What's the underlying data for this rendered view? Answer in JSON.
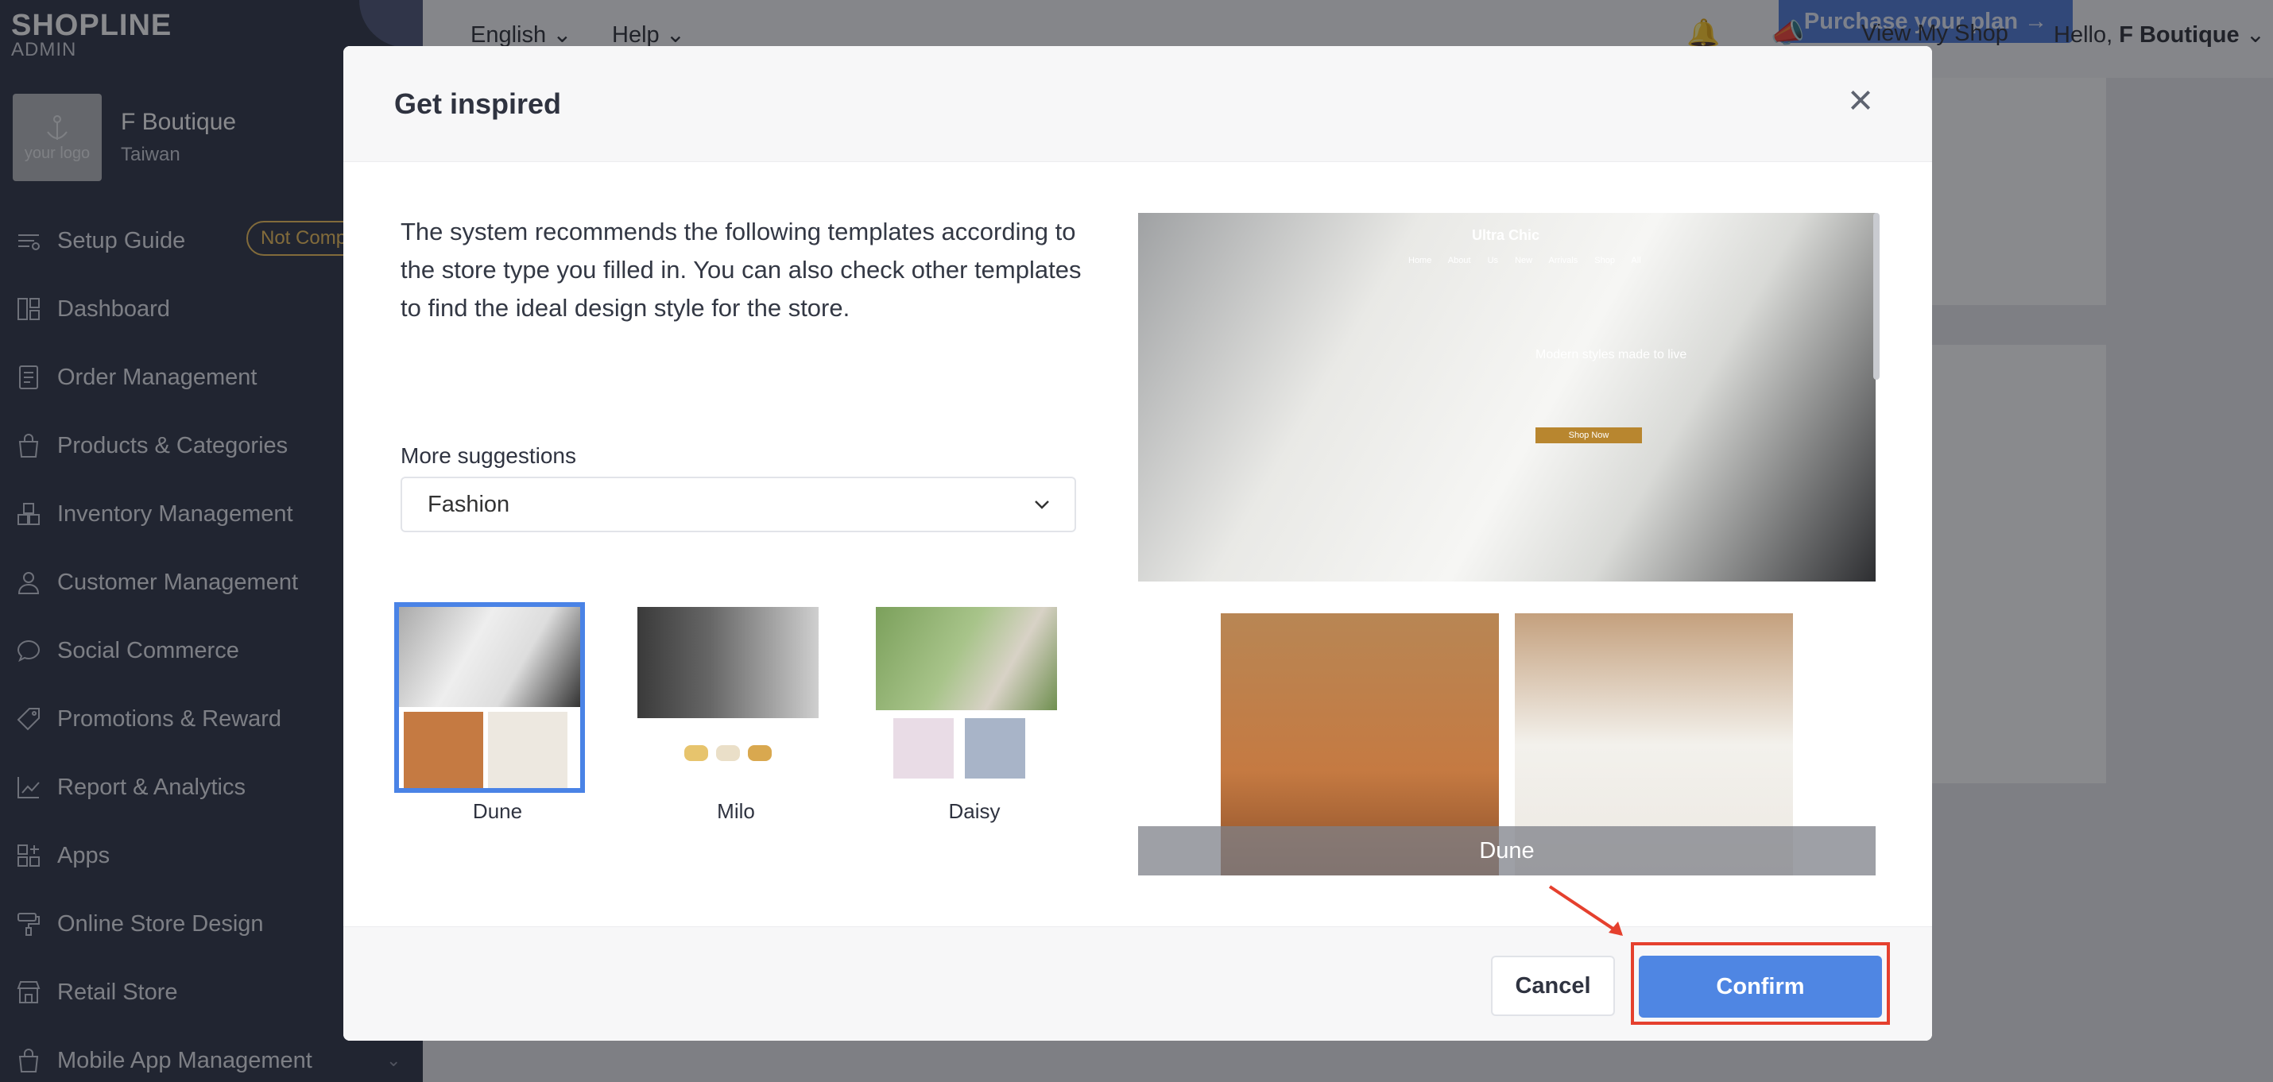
{
  "brand": {
    "name": "SHOPLINE",
    "sub": "ADMIN"
  },
  "store": {
    "logo_text": "your logo",
    "name": "F Boutique",
    "country": "Taiwan"
  },
  "sidebar": {
    "items": [
      {
        "label": "Setup Guide",
        "icon": "setup-guide-icon",
        "badge": "Not Comp"
      },
      {
        "label": "Dashboard",
        "icon": "dashboard-icon"
      },
      {
        "label": "Order Management",
        "icon": "order-icon"
      },
      {
        "label": "Products & Categories",
        "icon": "bag-icon"
      },
      {
        "label": "Inventory Management",
        "icon": "inventory-icon"
      },
      {
        "label": "Customer Management",
        "icon": "user-icon"
      },
      {
        "label": "Social Commerce",
        "icon": "chat-icon"
      },
      {
        "label": "Promotions & Reward",
        "icon": "tag-icon"
      },
      {
        "label": "Report & Analytics",
        "icon": "chart-icon"
      },
      {
        "label": "Apps",
        "icon": "apps-icon"
      },
      {
        "label": "Online Store Design",
        "icon": "paint-roller-icon"
      },
      {
        "label": "Retail Store",
        "icon": "store-icon"
      },
      {
        "label": "Mobile App Management",
        "icon": "mobile-icon"
      }
    ]
  },
  "topbar": {
    "language": "English",
    "help": "Help",
    "purchase": "Purchase your plan →",
    "view_shop": "View My Shop",
    "greeting": "Hello,",
    "user": "F Boutique"
  },
  "modal": {
    "title": "Get inspired",
    "description": "The system recommends the following templates according to the store type you filled in. You can also check other templates to find the ideal design style for the store.",
    "more_label": "More suggestions",
    "select_value": "Fashion",
    "templates": [
      {
        "name": "Dune",
        "selected": true
      },
      {
        "name": "Milo",
        "selected": false
      },
      {
        "name": "Daisy",
        "selected": false
      }
    ],
    "preview": {
      "site_title": "Ultra Chic",
      "nav": "Home About Us New Arrivals Shop All",
      "tagline": "Modern styles made to live",
      "button": "Shop Now",
      "caption": "Dune"
    },
    "cancel": "Cancel",
    "confirm": "Confirm"
  }
}
